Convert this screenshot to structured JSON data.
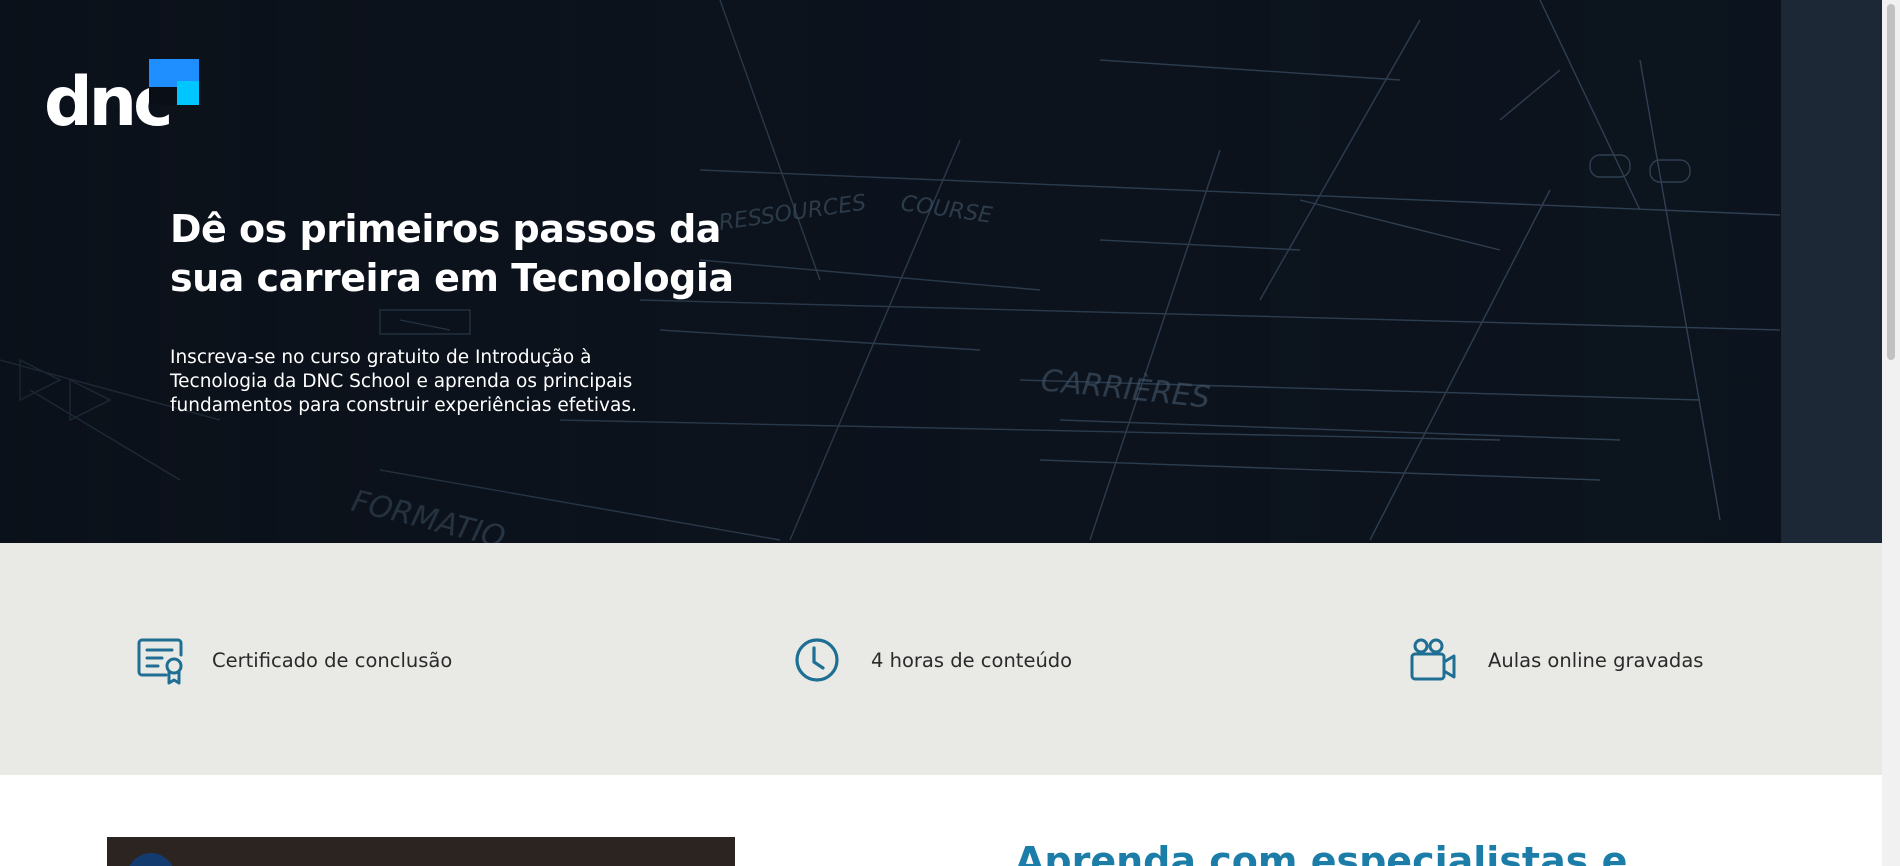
{
  "hero": {
    "logo_text": "dnc",
    "title_line1": "Dê os primeiros passos da",
    "title_line2": "sua carreira em Tecnologia",
    "sub_line1": "Inscreva-se no curso gratuito de Introdução à",
    "sub_line2": "Tecnologia da DNC School e aprenda os principais",
    "sub_line3": "fundamentos para construir experiências efetivas.",
    "bg_words": [
      "CARRIÈRES",
      "FORMATIO"
    ]
  },
  "features": [
    {
      "label": "Certificado de conclusão",
      "icon": "certificate-icon"
    },
    {
      "label": "4 horas de conteúdo",
      "icon": "clock-icon"
    },
    {
      "label": "Aulas online gravadas",
      "icon": "video-camera-icon"
    }
  ],
  "lower": {
    "title": "Aprenda com especialistas e"
  },
  "colors": {
    "hero_bg": "#0a0f17",
    "features_bg": "#e9eae5",
    "accent": "#1c7ea8",
    "logo_blue": "#1f8fff",
    "logo_cyan": "#00c6ff"
  }
}
